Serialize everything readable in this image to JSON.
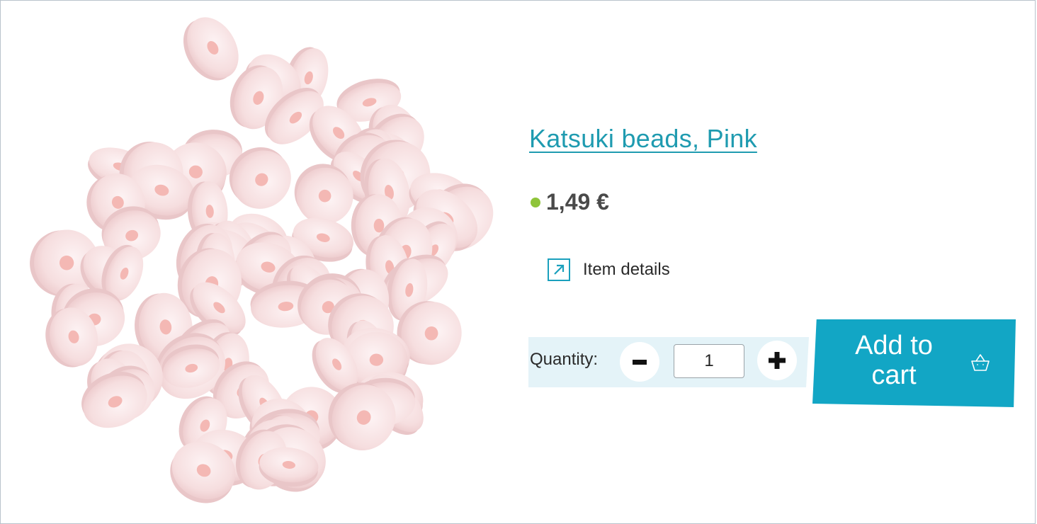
{
  "product": {
    "title": "Katsuki beads, Pink",
    "price": "1,49 €",
    "details_label": "Item details"
  },
  "quantity": {
    "label": "Quantity:",
    "value": "1"
  },
  "cart": {
    "label": "Add to cart"
  },
  "icons": {
    "stock": "stock-indicator-dot",
    "details": "external-arrow-icon",
    "minus": "minus-icon",
    "plus": "plus-icon",
    "basket": "basket-icon"
  },
  "colors": {
    "accent": "#12a6c5",
    "title": "#1f9bb0",
    "stock": "#8fc43a",
    "qty_panel": "#e4f3f8"
  }
}
